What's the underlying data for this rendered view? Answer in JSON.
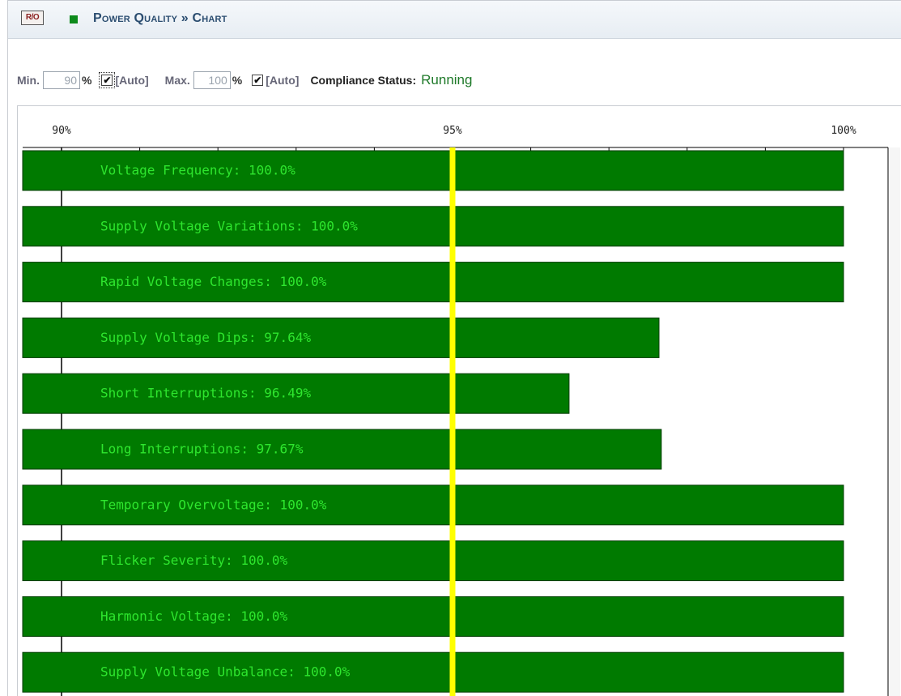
{
  "header": {
    "badge": "R/O",
    "title": "Power Quality » Chart"
  },
  "controls": {
    "min_label": "Min.",
    "min_value": "90",
    "min_unit": "%",
    "min_auto_checked": true,
    "auto_label": "[Auto]",
    "max_label": "Max.",
    "max_value": "100",
    "max_unit": "%",
    "max_auto_checked": true,
    "status_label": "Compliance Status:",
    "status_value": "Running"
  },
  "colors": {
    "bar_fill": "#007a00",
    "bar_text": "#2ee62e",
    "threshold_line": "#ffff00",
    "status_text": "#1f7a2a"
  },
  "chart_data": {
    "type": "bar",
    "orientation": "horizontal",
    "xlim": [
      90,
      100
    ],
    "threshold": 95,
    "ticks": [
      "90%",
      "95%",
      "100%"
    ],
    "categories": [
      "Voltage Frequency",
      "Supply Voltage Variations",
      "Rapid Voltage Changes",
      "Supply Voltage Dips",
      "Short Interruptions",
      "Long Interruptions",
      "Temporary Overvoltage",
      "Flicker Severity",
      "Harmonic Voltage",
      "Supply Voltage Unbalance"
    ],
    "values": [
      100.0,
      100.0,
      100.0,
      97.64,
      96.49,
      97.67,
      100.0,
      100.0,
      100.0,
      100.0
    ],
    "labels": [
      "Voltage Frequency: 100.0%",
      "Supply Voltage Variations: 100.0%",
      "Rapid Voltage Changes: 100.0%",
      "Supply Voltage Dips: 97.64%",
      "Short Interruptions: 96.49%",
      "Long Interruptions: 97.67%",
      "Temporary Overvoltage: 100.0%",
      "Flicker Severity: 100.0%",
      "Harmonic Voltage: 100.0%",
      "Supply Voltage Unbalance: 100.0%"
    ]
  }
}
